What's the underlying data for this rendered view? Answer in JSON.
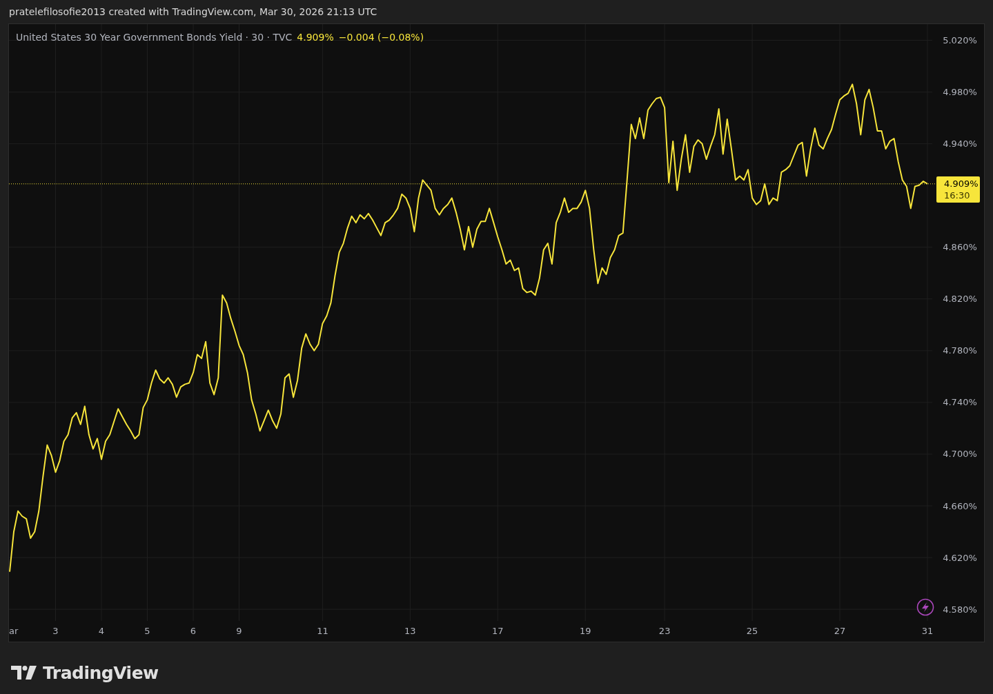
{
  "caption": "pratelefilosofie2013 created with TradingView.com, Mar 30, 2026 21:13 UTC",
  "chart": {
    "legend": {
      "suffix": "· 30 · TVC",
      "price": "4.909%",
      "change": "−0.004 (−0.08%)"
    },
    "last_price_label": {
      "price": "4.909%",
      "time": "16:30"
    },
    "chart_data": {
      "type": "line",
      "ylim": [
        4.571,
        5.032
      ],
      "grid": true,
      "categories": [
        null,
        "ar",
        null,
        null,
        null,
        null,
        null,
        null,
        null,
        null,
        null,
        "3",
        null,
        null,
        null,
        null,
        null,
        null,
        null,
        null,
        null,
        null,
        "4",
        null,
        null,
        null,
        null,
        null,
        null,
        null,
        null,
        null,
        null,
        "5",
        null,
        null,
        null,
        null,
        null,
        null,
        null,
        null,
        null,
        null,
        "6",
        null,
        null,
        null,
        null,
        null,
        null,
        null,
        null,
        null,
        null,
        "9",
        null,
        null,
        null,
        null,
        null,
        null,
        null,
        null,
        null,
        null,
        null,
        null,
        null,
        null,
        null,
        null,
        null,
        null,
        null,
        "11",
        null,
        null,
        null,
        null,
        null,
        null,
        null,
        null,
        null,
        null,
        null,
        null,
        null,
        null,
        null,
        null,
        null,
        null,
        null,
        null,
        "13",
        null,
        null,
        null,
        null,
        null,
        null,
        null,
        null,
        null,
        null,
        null,
        null,
        null,
        null,
        null,
        null,
        null,
        null,
        null,
        null,
        "17",
        null,
        null,
        null,
        null,
        null,
        null,
        null,
        null,
        null,
        null,
        null,
        null,
        null,
        null,
        null,
        null,
        null,
        null,
        null,
        null,
        "19",
        null,
        null,
        null,
        null,
        null,
        null,
        null,
        null,
        null,
        null,
        null,
        null,
        null,
        null,
        null,
        null,
        null,
        null,
        "23",
        null,
        null,
        null,
        null,
        null,
        null,
        null,
        null,
        null,
        null,
        null,
        null,
        null,
        null,
        null,
        null,
        null,
        null,
        null,
        null,
        "25",
        null,
        null,
        null,
        null,
        null,
        null,
        null,
        null,
        null,
        null,
        null,
        null,
        null,
        null,
        null,
        null,
        null,
        null,
        null,
        null,
        "27",
        null,
        null,
        null,
        null,
        null,
        null,
        null,
        null,
        null,
        null,
        null,
        null,
        null,
        null,
        null,
        null,
        null,
        null,
        null,
        null,
        "31"
      ],
      "ref_lines": [
        {
          "axis": "y",
          "value": 4.909,
          "color": "#f7e53b"
        }
      ],
      "series": [
        {
          "name": "United States 30 Year Government Bonds Yield",
          "color": "#f7e53b",
          "values": [
            4.609,
            4.64,
            4.656,
            4.652,
            4.65,
            4.635,
            4.64,
            4.656,
            4.683,
            4.707,
            4.699,
            4.686,
            4.695,
            4.71,
            4.715,
            4.728,
            4.732,
            4.723,
            4.737,
            4.715,
            4.704,
            4.712,
            4.696,
            4.71,
            4.715,
            4.725,
            4.735,
            4.729,
            4.723,
            4.718,
            4.712,
            4.715,
            4.736,
            4.742,
            4.755,
            4.765,
            4.758,
            4.755,
            4.759,
            4.754,
            4.744,
            4.752,
            4.754,
            4.755,
            4.763,
            4.777,
            4.774,
            4.787,
            4.755,
            4.746,
            4.759,
            4.823,
            4.817,
            4.805,
            4.795,
            4.784,
            4.777,
            4.763,
            4.742,
            4.731,
            4.718,
            4.726,
            4.734,
            4.726,
            4.72,
            4.731,
            4.759,
            4.762,
            4.744,
            4.757,
            4.782,
            4.793,
            4.785,
            4.78,
            4.785,
            4.801,
            4.807,
            4.817,
            4.838,
            4.856,
            4.863,
            4.875,
            4.884,
            4.879,
            4.885,
            4.882,
            4.886,
            4.881,
            4.875,
            4.869,
            4.879,
            4.881,
            4.885,
            4.89,
            4.901,
            4.898,
            4.89,
            4.872,
            4.898,
            4.912,
            4.908,
            4.904,
            4.89,
            4.885,
            4.89,
            4.893,
            4.898,
            4.887,
            4.874,
            4.858,
            4.876,
            4.86,
            4.874,
            4.88,
            4.88,
            4.89,
            4.879,
            4.868,
            4.858,
            4.847,
            4.85,
            4.842,
            4.844,
            4.828,
            4.825,
            4.826,
            4.823,
            4.836,
            4.858,
            4.863,
            4.847,
            4.879,
            4.887,
            4.898,
            4.887,
            4.89,
            4.89,
            4.895,
            4.904,
            4.89,
            4.858,
            4.832,
            4.844,
            4.839,
            4.852,
            4.858,
            4.869,
            4.871,
            4.912,
            4.955,
            4.944,
            4.96,
            4.944,
            4.966,
            4.971,
            4.975,
            4.976,
            4.968,
            4.91,
            4.942,
            4.904,
            4.928,
            4.947,
            4.918,
            4.938,
            4.943,
            4.94,
            4.928,
            4.938,
            4.947,
            4.967,
            4.932,
            4.959,
            4.936,
            4.912,
            4.915,
            4.912,
            4.92,
            4.898,
            4.893,
            4.896,
            4.909,
            4.893,
            4.898,
            4.896,
            4.918,
            4.92,
            4.923,
            4.931,
            4.939,
            4.941,
            4.915,
            4.936,
            4.952,
            4.939,
            4.936,
            4.944,
            4.951,
            4.963,
            4.974,
            4.977,
            4.979,
            4.986,
            4.971,
            4.947,
            4.974,
            4.982,
            4.968,
            4.95,
            4.95,
            4.936,
            4.942,
            4.944,
            4.926,
            4.912,
            4.907,
            4.89,
            4.907,
            4.908,
            4.911,
            4.909
          ]
        }
      ],
      "yticks": [
        {
          "value": 5.02,
          "label": "5.020%"
        },
        {
          "value": 4.98,
          "label": "4.980%"
        },
        {
          "value": 4.94,
          "label": "4.940%"
        },
        {
          "value": 4.86,
          "label": "4.860%"
        },
        {
          "value": 4.82,
          "label": "4.820%"
        },
        {
          "value": 4.78,
          "label": "4.780%"
        },
        {
          "value": 4.74,
          "label": "4.740%"
        },
        {
          "value": 4.7,
          "label": "4.700%"
        },
        {
          "value": 4.66,
          "label": "4.660%"
        },
        {
          "value": 4.62,
          "label": "4.620%"
        },
        {
          "value": 4.58,
          "label": "4.580%"
        }
      ]
    }
  },
  "footer": {
    "logo_text": "TradingView"
  }
}
